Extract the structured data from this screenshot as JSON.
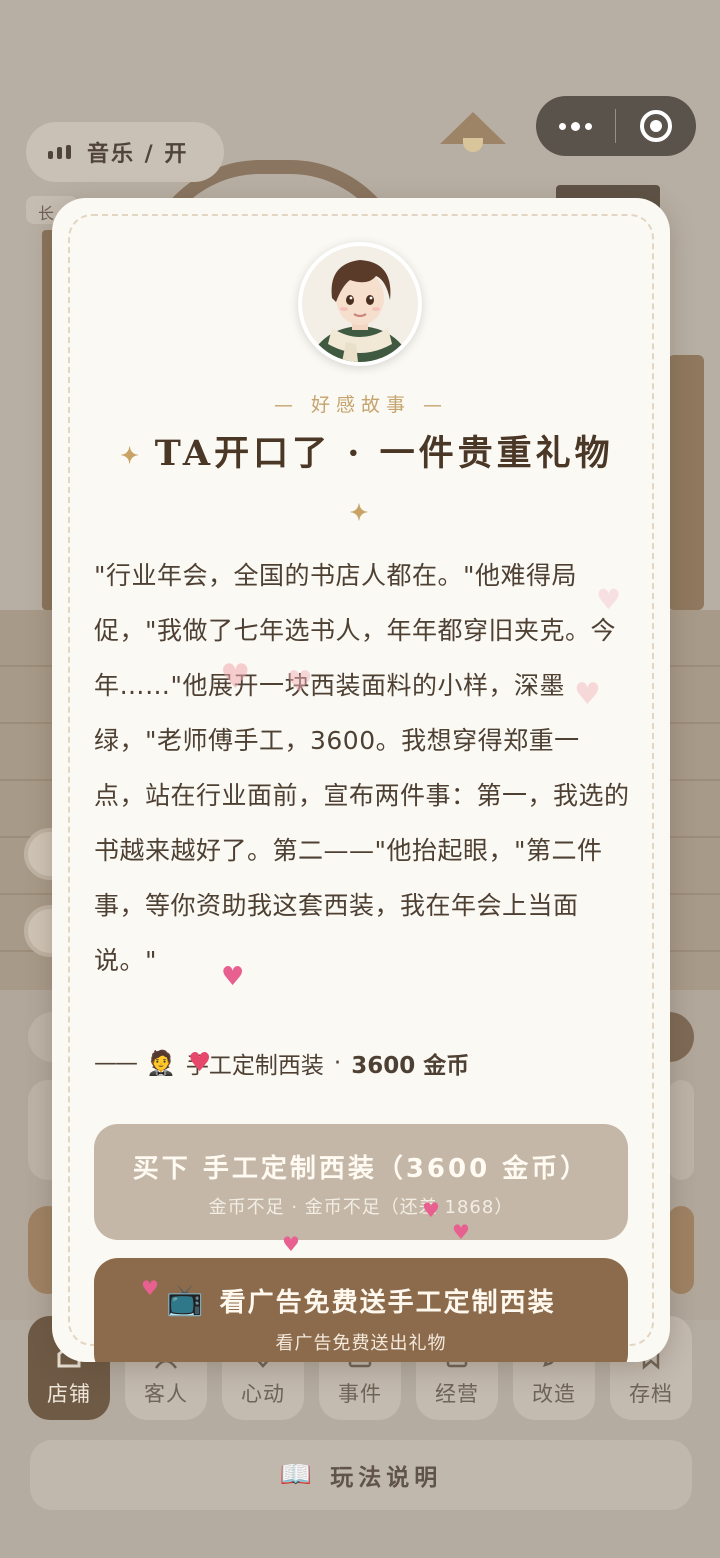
{
  "top_bar": {
    "music_label": "音乐 / 开",
    "tag_label": "长"
  },
  "modal": {
    "section_tag": "— 好感故事 —",
    "title": "TA开口了 · 一件贵重礼物",
    "story": "\"行业年会，全国的书店人都在。\"他难得局促，\"我做了七年选书人，年年都穿旧夹克。今年……\"他展开一块西装面料的小样，深墨绿，\"老师傅手工，3600。我想穿得郑重一点，站在行业面前，宣布两件事：第一，我选的书越来越好了。第二——\"他抬起眼，\"第二件事，等你资助我这套西装，我在年会上当面说。\"",
    "gift": {
      "dash": "——",
      "icon": "🤵",
      "name": "手工定制西装",
      "separator": "·",
      "price": "3600 金币"
    },
    "buy_button": {
      "label": "买下 手工定制西装（3600 金币）",
      "sub": "金币不足 · 金币不足（还差 1868）"
    },
    "ad_button": {
      "icon": "📺",
      "label": "看广告免费送手工定制西装",
      "sub": "看广告免费送出礼物"
    }
  },
  "bottom_nav": {
    "items": [
      {
        "label": "店铺",
        "icon": "shop-icon",
        "active": true
      },
      {
        "label": "客人",
        "icon": "guest-icon"
      },
      {
        "label": "心动",
        "icon": "heart-icon"
      },
      {
        "label": "事件",
        "icon": "event-icon"
      },
      {
        "label": "经营",
        "icon": "manage-icon"
      },
      {
        "label": "改造",
        "icon": "edit-icon"
      },
      {
        "label": "存档",
        "icon": "bookmark-icon"
      }
    ]
  },
  "help": {
    "icon": "📖",
    "label": "玩法说明"
  },
  "colors": {
    "accent_brown": "#8c6b4c",
    "disabled_button": "#c4b7a7",
    "gold": "#c6a46e",
    "heart_pink": "#e85a8a"
  }
}
